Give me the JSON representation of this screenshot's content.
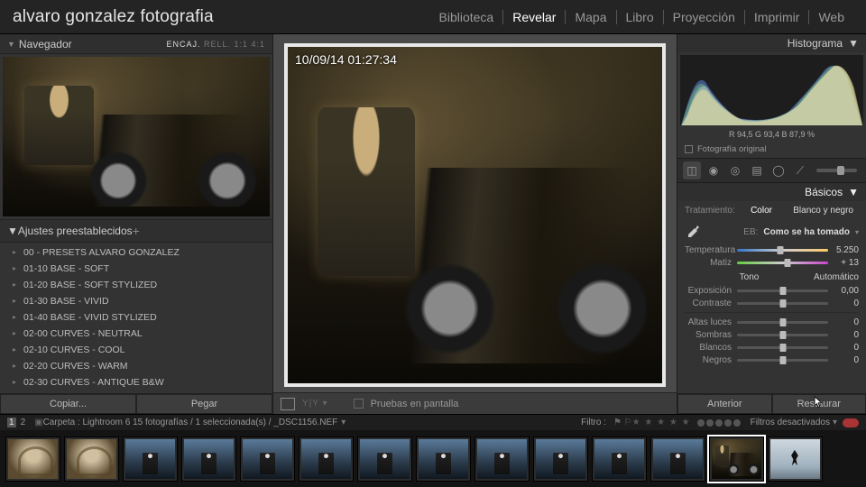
{
  "identity": "alvaro gonzalez fotografia",
  "modules": [
    "Biblioteca",
    "Revelar",
    "Mapa",
    "Libro",
    "Proyección",
    "Imprimir",
    "Web"
  ],
  "active_module": "Revelar",
  "navigator": {
    "title": "Navegador",
    "modes": "ENCAJ.   RELL.   1:1   4:1"
  },
  "presets": {
    "title": "Ajustes preestablecidos",
    "items": [
      "00 - PRESETS ALVARO GONZALEZ",
      "01-10 BASE - SOFT",
      "01-20 BASE - SOFT STYLIZED",
      "01-30 BASE - VIVID",
      "01-40 BASE - VIVID STYLIZED",
      "02-00 CURVES - NEUTRAL",
      "02-10 CURVES - COOL",
      "02-20 CURVES - WARM",
      "02-30 CURVES - ANTIQUE B&W"
    ]
  },
  "left_buttons": {
    "copy": "Copiar...",
    "paste": "Pegar"
  },
  "center": {
    "timestamp": "10/09/14 01:27:34",
    "soft_proof": "Pruebas en pantalla"
  },
  "histogram": {
    "title": "Histograma",
    "readout": "R  94,5   G  93,4   B  87,9 %",
    "original": "Fotografía original"
  },
  "basics": {
    "title": "Básicos",
    "treatment_label": "Tratamiento:",
    "treatment_color": "Color",
    "treatment_bw": "Blanco y negro",
    "wb_label": "EB:",
    "wb_value": "Como se ha tomado",
    "tone_label": "Tono",
    "auto_label": "Automático",
    "sliders_wb": [
      {
        "name": "Temperatura",
        "value": "5.250",
        "pos": 48,
        "track": "rainbow"
      },
      {
        "name": "Matiz",
        "value": "+ 13",
        "pos": 55,
        "track": "gm"
      }
    ],
    "sliders_exp": [
      {
        "name": "Exposición",
        "value": "0,00",
        "pos": 50
      },
      {
        "name": "Contraste",
        "value": "0",
        "pos": 50
      }
    ],
    "sliders_tone": [
      {
        "name": "Altas luces",
        "value": "0",
        "pos": 50
      },
      {
        "name": "Sombras",
        "value": "0",
        "pos": 50
      },
      {
        "name": "Blancos",
        "value": "0",
        "pos": 50
      },
      {
        "name": "Negros",
        "value": "0",
        "pos": 50
      }
    ]
  },
  "right_buttons": {
    "prev": "Anterior",
    "reset": "Restaurar"
  },
  "infobar": {
    "pages": [
      "1",
      "2"
    ],
    "breadcrumb": "Carpeta : Lightroom 6    15 fotografías / 1 seleccionada(s) / _DSC1156.NEF",
    "filter_label": "Filtro :",
    "filters_off": "Filtros desactivados"
  },
  "filmstrip": {
    "thumbs": [
      "arch",
      "arch",
      "blue",
      "blue",
      "blue",
      "blue",
      "blue",
      "blue",
      "blue",
      "blue",
      "blue",
      "blue",
      "workshop",
      "jump"
    ],
    "selected_index": 12
  }
}
